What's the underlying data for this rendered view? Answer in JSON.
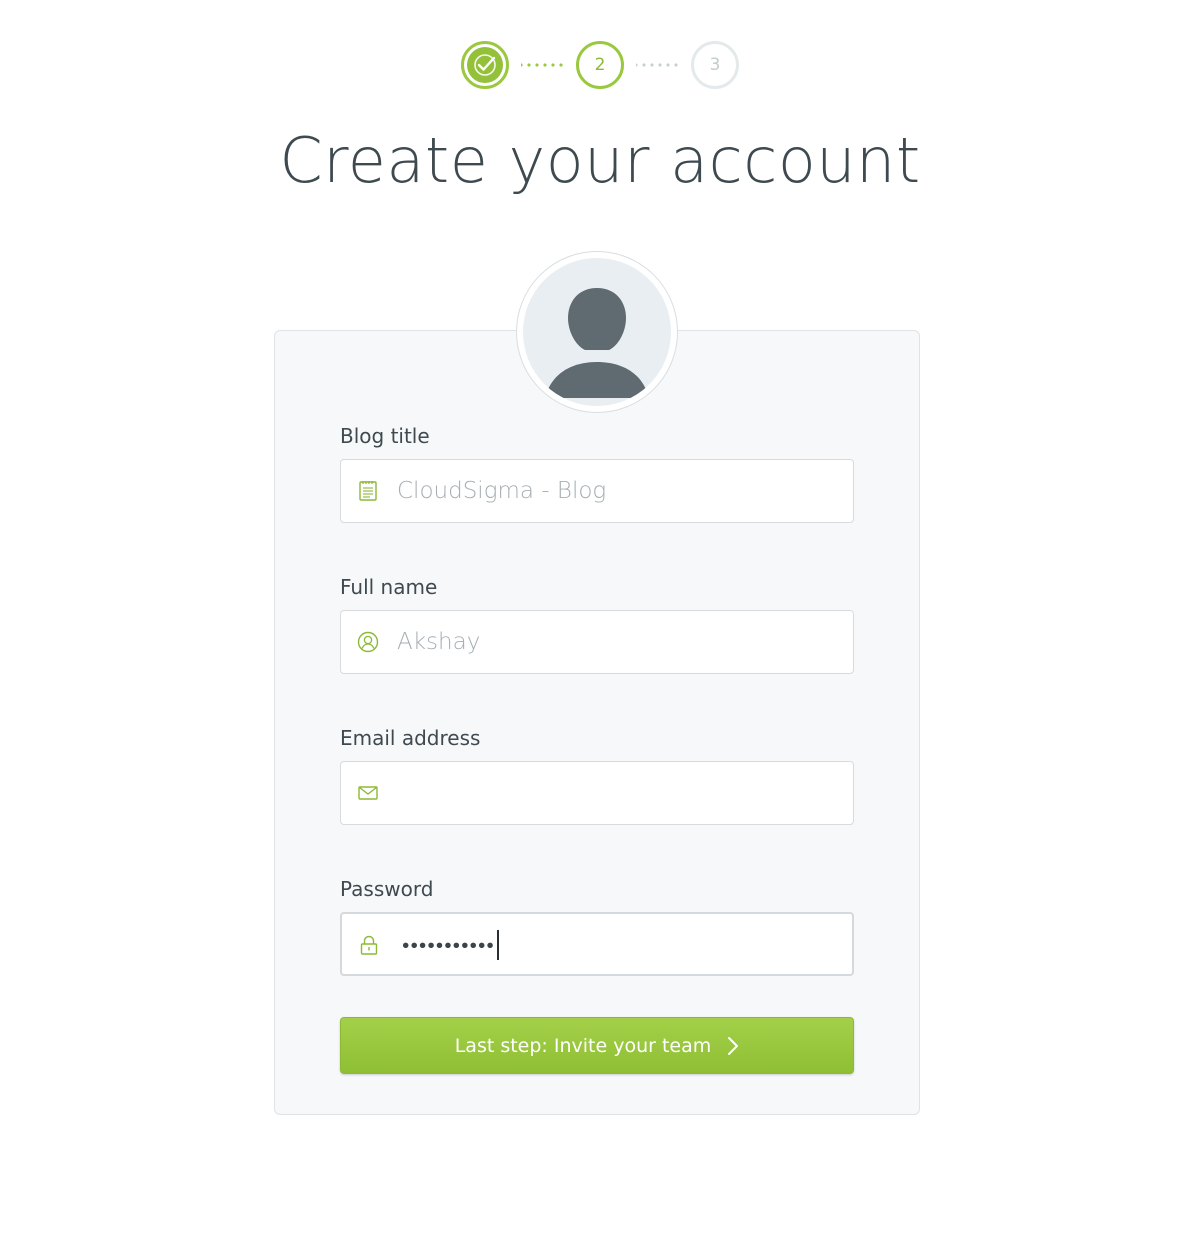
{
  "stepper": {
    "steps": [
      {
        "label": "",
        "state": "done"
      },
      {
        "label": "2",
        "state": "current"
      },
      {
        "label": "3",
        "state": "pending"
      }
    ]
  },
  "page_title": "Create your account",
  "form": {
    "blog_title": {
      "label": "Blog title",
      "placeholder": "CloudSigma - Blog",
      "icon": "notepad-icon"
    },
    "full_name": {
      "label": "Full name",
      "placeholder": "Akshay",
      "icon": "user-icon"
    },
    "email": {
      "label": "Email address",
      "placeholder": "",
      "icon": "envelope-icon"
    },
    "password": {
      "label": "Password",
      "masked_value": "•••••••••••",
      "icon": "lock-icon"
    },
    "submit_label": "Last step: Invite your team"
  },
  "colors": {
    "accent": "#9ac83e",
    "button": "#98c73e",
    "card_bg": "#f7f8fa"
  }
}
